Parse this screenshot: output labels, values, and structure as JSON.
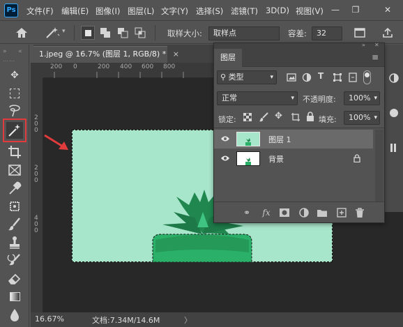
{
  "menubar": {
    "logo": "Ps",
    "items": [
      "文件(F)",
      "编辑(E)",
      "图像(I)",
      "图层(L)",
      "文字(Y)",
      "选择(S)",
      "滤镜(T)",
      "3D(D)",
      "视图(V)"
    ]
  },
  "options": {
    "sample_size_label": "取样大小:",
    "sample_size_value": "取样点",
    "tolerance_label": "容差:",
    "tolerance_value": "32"
  },
  "document": {
    "tab_title": "1.jpeg @ 16.7% (图层 1, RGB/8) *",
    "close_glyph": "×",
    "ruler_h_labels": [
      "200",
      "0",
      "200",
      "400",
      "600",
      "800"
    ],
    "ruler_v_labels": [
      "2",
      "0",
      "0",
      "2",
      "0",
      "0",
      "4",
      "0",
      "0"
    ]
  },
  "status": {
    "zoom": "16.67%",
    "doc_size": "文档:7.34M/14.6M",
    "arrow": "〉"
  },
  "layers_panel": {
    "tab_label": "图层",
    "kind_label": "类型",
    "blend_mode": "正常",
    "opacity_label": "不透明度:",
    "opacity_value": "100%",
    "lock_label": "锁定:",
    "fill_label": "填充:",
    "fill_value": "100%",
    "layers": [
      {
        "name": "图层 1",
        "selected": true,
        "locked": false
      },
      {
        "name": "背景",
        "selected": false,
        "locked": true
      }
    ]
  },
  "colors": {
    "canvas_bg": "#282828",
    "image_mint": "#a8e6cb",
    "plant_green": "#2bb06a",
    "highlight_red": "#e23b3b",
    "accent_blue": "#31a8ff"
  }
}
